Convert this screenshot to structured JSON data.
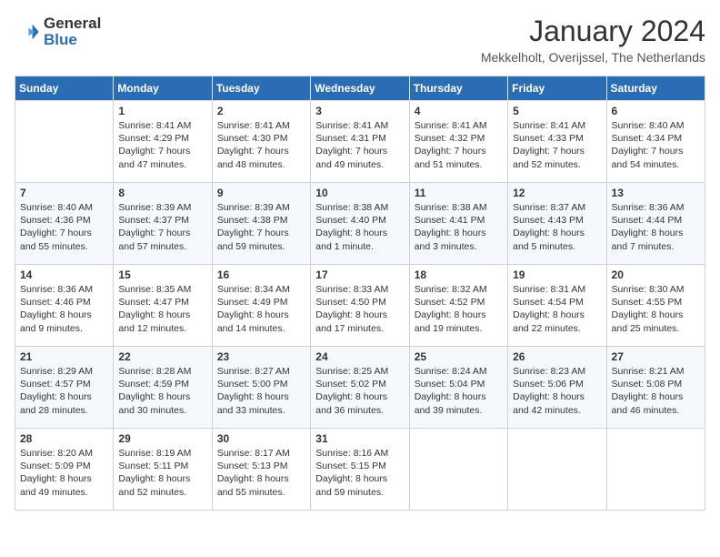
{
  "header": {
    "logo_general": "General",
    "logo_blue": "Blue",
    "month_title": "January 2024",
    "location": "Mekkelholt, Overijssel, The Netherlands"
  },
  "weekdays": [
    "Sunday",
    "Monday",
    "Tuesday",
    "Wednesday",
    "Thursday",
    "Friday",
    "Saturday"
  ],
  "rows": [
    [
      {
        "num": "",
        "lines": []
      },
      {
        "num": "1",
        "lines": [
          "Sunrise: 8:41 AM",
          "Sunset: 4:29 PM",
          "Daylight: 7 hours",
          "and 47 minutes."
        ]
      },
      {
        "num": "2",
        "lines": [
          "Sunrise: 8:41 AM",
          "Sunset: 4:30 PM",
          "Daylight: 7 hours",
          "and 48 minutes."
        ]
      },
      {
        "num": "3",
        "lines": [
          "Sunrise: 8:41 AM",
          "Sunset: 4:31 PM",
          "Daylight: 7 hours",
          "and 49 minutes."
        ]
      },
      {
        "num": "4",
        "lines": [
          "Sunrise: 8:41 AM",
          "Sunset: 4:32 PM",
          "Daylight: 7 hours",
          "and 51 minutes."
        ]
      },
      {
        "num": "5",
        "lines": [
          "Sunrise: 8:41 AM",
          "Sunset: 4:33 PM",
          "Daylight: 7 hours",
          "and 52 minutes."
        ]
      },
      {
        "num": "6",
        "lines": [
          "Sunrise: 8:40 AM",
          "Sunset: 4:34 PM",
          "Daylight: 7 hours",
          "and 54 minutes."
        ]
      }
    ],
    [
      {
        "num": "7",
        "lines": [
          "Sunrise: 8:40 AM",
          "Sunset: 4:36 PM",
          "Daylight: 7 hours",
          "and 55 minutes."
        ]
      },
      {
        "num": "8",
        "lines": [
          "Sunrise: 8:39 AM",
          "Sunset: 4:37 PM",
          "Daylight: 7 hours",
          "and 57 minutes."
        ]
      },
      {
        "num": "9",
        "lines": [
          "Sunrise: 8:39 AM",
          "Sunset: 4:38 PM",
          "Daylight: 7 hours",
          "and 59 minutes."
        ]
      },
      {
        "num": "10",
        "lines": [
          "Sunrise: 8:38 AM",
          "Sunset: 4:40 PM",
          "Daylight: 8 hours",
          "and 1 minute."
        ]
      },
      {
        "num": "11",
        "lines": [
          "Sunrise: 8:38 AM",
          "Sunset: 4:41 PM",
          "Daylight: 8 hours",
          "and 3 minutes."
        ]
      },
      {
        "num": "12",
        "lines": [
          "Sunrise: 8:37 AM",
          "Sunset: 4:43 PM",
          "Daylight: 8 hours",
          "and 5 minutes."
        ]
      },
      {
        "num": "13",
        "lines": [
          "Sunrise: 8:36 AM",
          "Sunset: 4:44 PM",
          "Daylight: 8 hours",
          "and 7 minutes."
        ]
      }
    ],
    [
      {
        "num": "14",
        "lines": [
          "Sunrise: 8:36 AM",
          "Sunset: 4:46 PM",
          "Daylight: 8 hours",
          "and 9 minutes."
        ]
      },
      {
        "num": "15",
        "lines": [
          "Sunrise: 8:35 AM",
          "Sunset: 4:47 PM",
          "Daylight: 8 hours",
          "and 12 minutes."
        ]
      },
      {
        "num": "16",
        "lines": [
          "Sunrise: 8:34 AM",
          "Sunset: 4:49 PM",
          "Daylight: 8 hours",
          "and 14 minutes."
        ]
      },
      {
        "num": "17",
        "lines": [
          "Sunrise: 8:33 AM",
          "Sunset: 4:50 PM",
          "Daylight: 8 hours",
          "and 17 minutes."
        ]
      },
      {
        "num": "18",
        "lines": [
          "Sunrise: 8:32 AM",
          "Sunset: 4:52 PM",
          "Daylight: 8 hours",
          "and 19 minutes."
        ]
      },
      {
        "num": "19",
        "lines": [
          "Sunrise: 8:31 AM",
          "Sunset: 4:54 PM",
          "Daylight: 8 hours",
          "and 22 minutes."
        ]
      },
      {
        "num": "20",
        "lines": [
          "Sunrise: 8:30 AM",
          "Sunset: 4:55 PM",
          "Daylight: 8 hours",
          "and 25 minutes."
        ]
      }
    ],
    [
      {
        "num": "21",
        "lines": [
          "Sunrise: 8:29 AM",
          "Sunset: 4:57 PM",
          "Daylight: 8 hours",
          "and 28 minutes."
        ]
      },
      {
        "num": "22",
        "lines": [
          "Sunrise: 8:28 AM",
          "Sunset: 4:59 PM",
          "Daylight: 8 hours",
          "and 30 minutes."
        ]
      },
      {
        "num": "23",
        "lines": [
          "Sunrise: 8:27 AM",
          "Sunset: 5:00 PM",
          "Daylight: 8 hours",
          "and 33 minutes."
        ]
      },
      {
        "num": "24",
        "lines": [
          "Sunrise: 8:25 AM",
          "Sunset: 5:02 PM",
          "Daylight: 8 hours",
          "and 36 minutes."
        ]
      },
      {
        "num": "25",
        "lines": [
          "Sunrise: 8:24 AM",
          "Sunset: 5:04 PM",
          "Daylight: 8 hours",
          "and 39 minutes."
        ]
      },
      {
        "num": "26",
        "lines": [
          "Sunrise: 8:23 AM",
          "Sunset: 5:06 PM",
          "Daylight: 8 hours",
          "and 42 minutes."
        ]
      },
      {
        "num": "27",
        "lines": [
          "Sunrise: 8:21 AM",
          "Sunset: 5:08 PM",
          "Daylight: 8 hours",
          "and 46 minutes."
        ]
      }
    ],
    [
      {
        "num": "28",
        "lines": [
          "Sunrise: 8:20 AM",
          "Sunset: 5:09 PM",
          "Daylight: 8 hours",
          "and 49 minutes."
        ]
      },
      {
        "num": "29",
        "lines": [
          "Sunrise: 8:19 AM",
          "Sunset: 5:11 PM",
          "Daylight: 8 hours",
          "and 52 minutes."
        ]
      },
      {
        "num": "30",
        "lines": [
          "Sunrise: 8:17 AM",
          "Sunset: 5:13 PM",
          "Daylight: 8 hours",
          "and 55 minutes."
        ]
      },
      {
        "num": "31",
        "lines": [
          "Sunrise: 8:16 AM",
          "Sunset: 5:15 PM",
          "Daylight: 8 hours",
          "and 59 minutes."
        ]
      },
      {
        "num": "",
        "lines": []
      },
      {
        "num": "",
        "lines": []
      },
      {
        "num": "",
        "lines": []
      }
    ]
  ]
}
